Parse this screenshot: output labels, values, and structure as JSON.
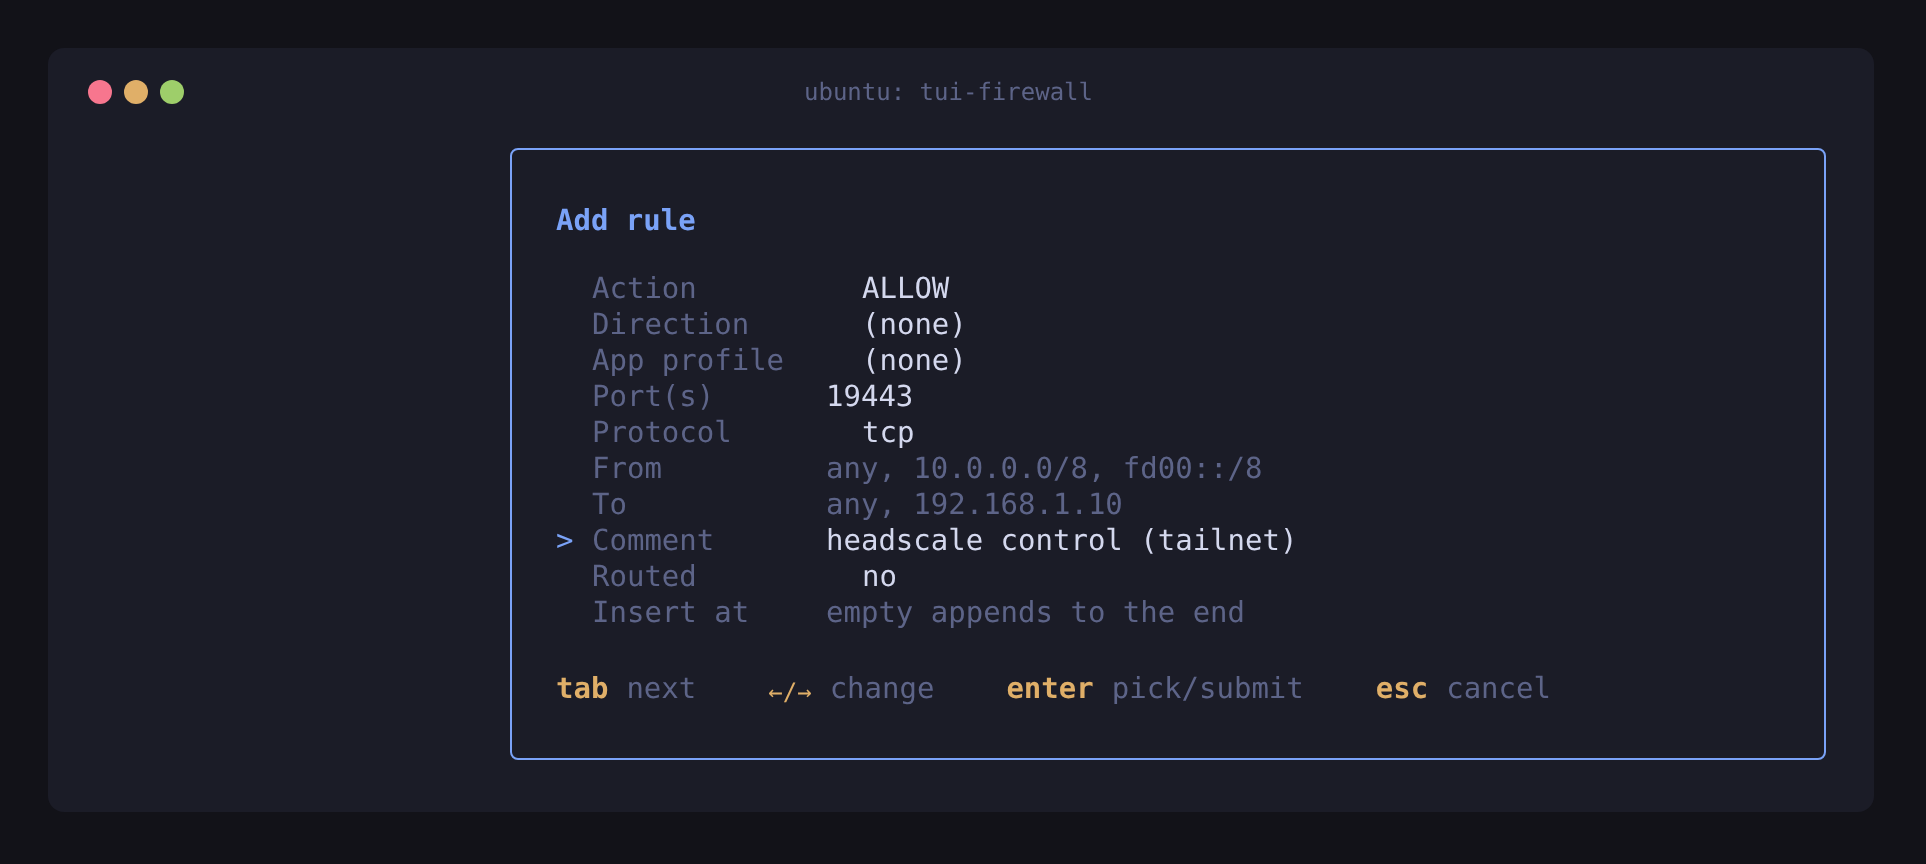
{
  "window": {
    "title": "ubuntu: tui-firewall"
  },
  "dialog": {
    "title": "Add rule",
    "fields": [
      {
        "label": "Action",
        "kind": "select",
        "value": "ALLOW",
        "selected": false
      },
      {
        "label": "Direction",
        "kind": "select",
        "value": "(none)",
        "selected": false
      },
      {
        "label": "App profile",
        "kind": "select",
        "value": "(none)",
        "selected": false
      },
      {
        "label": "Port(s)",
        "kind": "text",
        "value": "19443",
        "selected": false
      },
      {
        "label": "Protocol",
        "kind": "select",
        "value": "tcp",
        "selected": false
      },
      {
        "label": "From",
        "kind": "text",
        "placeholder": "any, 10.0.0.0/8, fd00::/8",
        "selected": false
      },
      {
        "label": "To",
        "kind": "text",
        "placeholder": "any, 192.168.1.10",
        "selected": false
      },
      {
        "label": "Comment",
        "kind": "text",
        "value": "headscale control (tailnet)",
        "selected": true
      },
      {
        "label": "Routed",
        "kind": "select",
        "value": "no",
        "selected": false
      },
      {
        "label": "Insert at",
        "kind": "text",
        "placeholder": "empty appends to the end",
        "selected": false
      }
    ],
    "cursor": ">",
    "hints": [
      {
        "key": "tab",
        "action": "next",
        "kind": "word"
      },
      {
        "key": "←/→",
        "action": "change",
        "kind": "arrows"
      },
      {
        "key": "enter",
        "action": "pick/submit",
        "kind": "word"
      },
      {
        "key": "esc",
        "action": "cancel",
        "kind": "word"
      }
    ]
  }
}
